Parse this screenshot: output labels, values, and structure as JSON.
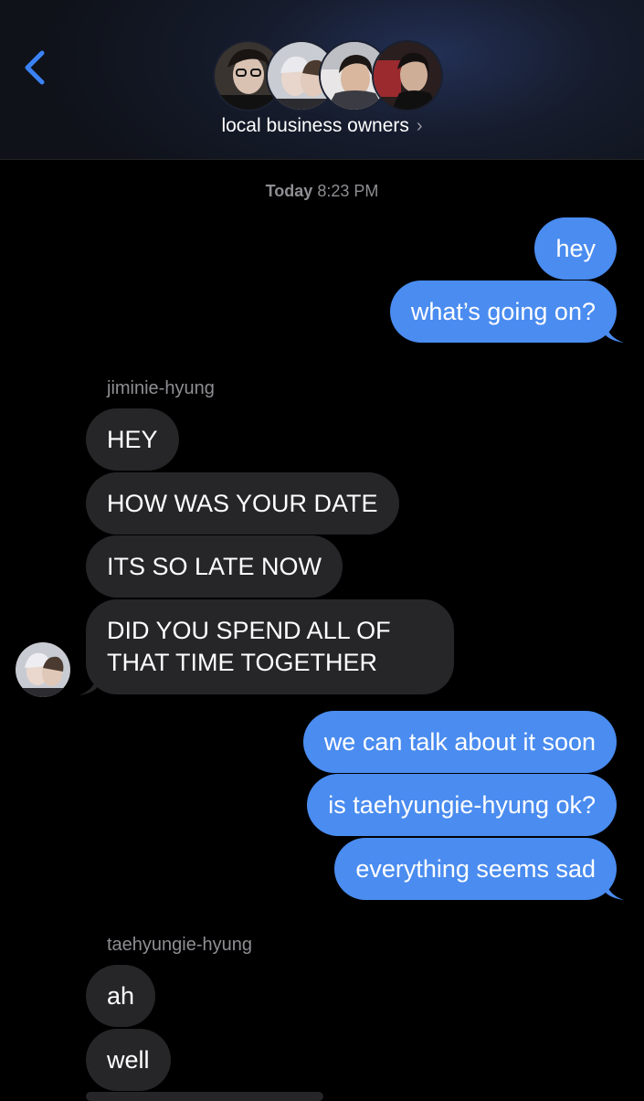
{
  "header": {
    "back_icon": "chevron-left-icon",
    "group_name": "local business owners",
    "chevron": "›",
    "avatar_count": 4
  },
  "timestamp": {
    "day": "Today",
    "time": "8:23 PM"
  },
  "senders": {
    "first": "jiminie-hyung",
    "second": "taehyungie-hyung"
  },
  "messages": [
    {
      "from": "me",
      "text": "hey"
    },
    {
      "from": "me",
      "text": "what’s going on?"
    },
    {
      "from": "jiminie-hyung",
      "text": "HEY"
    },
    {
      "from": "jiminie-hyung",
      "text": "HOW WAS YOUR DATE"
    },
    {
      "from": "jiminie-hyung",
      "text": "ITS SO LATE NOW"
    },
    {
      "from": "jiminie-hyung",
      "text": "DID YOU SPEND ALL OF THAT TIME TOGETHER"
    },
    {
      "from": "me",
      "text": "we can talk about it soon"
    },
    {
      "from": "me",
      "text": "is taehyungie-hyung ok?"
    },
    {
      "from": "me",
      "text": "everything seems sad"
    },
    {
      "from": "taehyungie-hyung",
      "text": "ah"
    },
    {
      "from": "taehyungie-hyung",
      "text": "well"
    }
  ],
  "colors": {
    "outgoing_bubble": "#4a8cf0",
    "incoming_bubble": "#262628",
    "background": "#000000",
    "accent": "#3b82f6",
    "meta_text": "#8e8e93"
  }
}
